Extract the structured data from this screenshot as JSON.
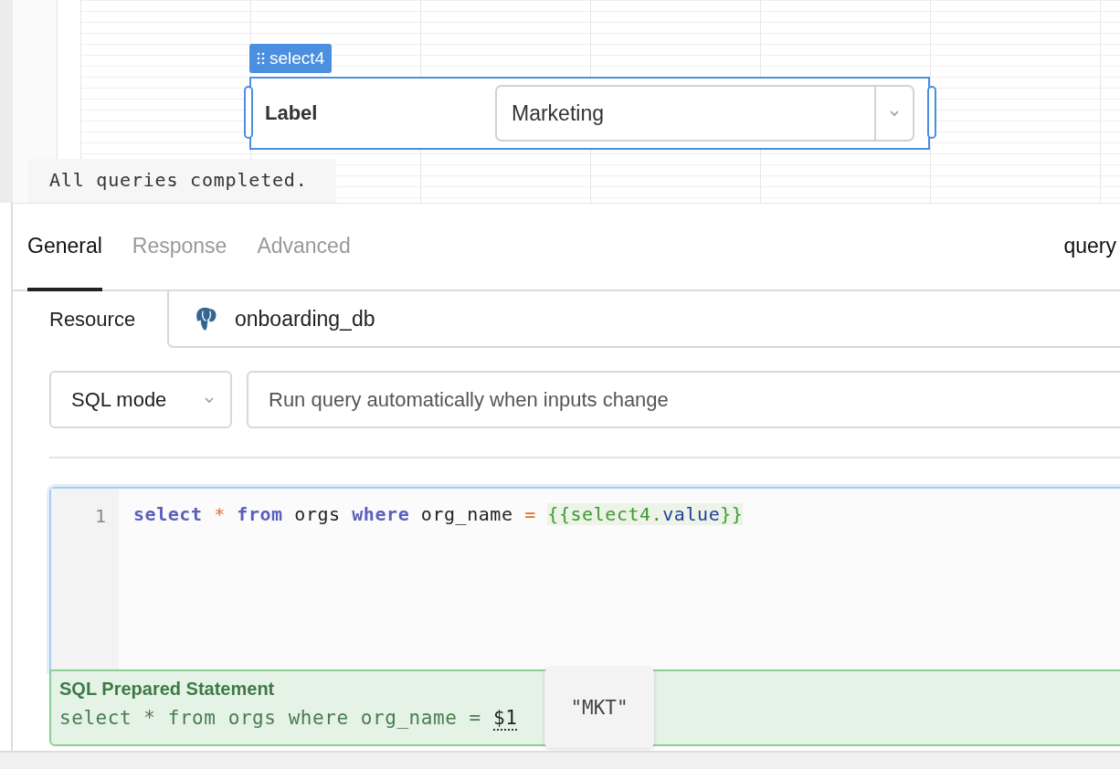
{
  "canvas": {
    "widget": {
      "name": "select4",
      "label": "Label",
      "value": "Marketing",
      "selected": true
    }
  },
  "status_message": "All queries completed.",
  "query_panel": {
    "tabs": [
      {
        "label": "General",
        "selected": true
      },
      {
        "label": "Response",
        "selected": false
      },
      {
        "label": "Advanced",
        "selected": false
      }
    ],
    "query_name": "query",
    "resource": {
      "label": "Resource",
      "value": "onboarding_db"
    },
    "mode": {
      "value": "SQL mode"
    },
    "trigger": {
      "value": "Run query automatically when inputs change"
    },
    "editor": {
      "lines": [
        {
          "number": "1",
          "tokens": [
            {
              "kind": "keyword",
              "text": "select"
            },
            {
              "kind": "operator",
              "text": "*"
            },
            {
              "kind": "keyword",
              "text": "from"
            },
            {
              "kind": "plain",
              "text": "orgs"
            },
            {
              "kind": "keyword",
              "text": "where"
            },
            {
              "kind": "plain",
              "text": "org_name"
            },
            {
              "kind": "operator",
              "text": "="
            },
            {
              "kind": "template",
              "parts": [
                {
                  "kind": "brace",
                  "text": "{{"
                },
                {
                  "kind": "name",
                  "text": "select4."
                },
                {
                  "kind": "property",
                  "text": "value"
                },
                {
                  "kind": "brace",
                  "text": "}}"
                }
              ]
            }
          ]
        }
      ]
    },
    "prepared_statement": {
      "title": "SQL Prepared Statement",
      "sql": "select * from orgs where org_name =",
      "param": "$1"
    },
    "tooltip": {
      "text": "\"MKT\""
    }
  }
}
